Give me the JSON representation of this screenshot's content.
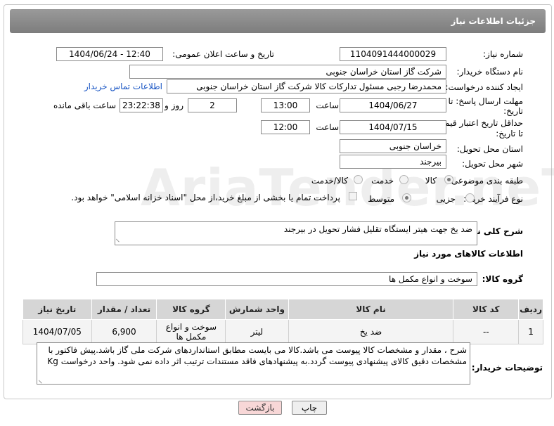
{
  "header": {
    "title": "جزئیات اطلاعات نیاز"
  },
  "fields": {
    "need_number_label": "شماره نیاز:",
    "need_number": "1104091444000029",
    "announce_label": "تاریخ و ساعت اعلان عمومی:",
    "announce_value": "1404/06/24 - 12:40",
    "buyer_org_label": "نام دستگاه خریدار:",
    "buyer_org": "شرکت گاز استان خراسان جنوبی",
    "creator_label": "ایجاد کننده درخواست:",
    "creator": "محمدرضا رجبی مسئول تدارکات کالا شرکت گاز استان خراسان جنوبی",
    "contact_link": "اطلاعات تماس خریدار",
    "deadline_label_1": "مهلت ارسال پاسخ: تا",
    "deadline_label_2": "تاریخ:",
    "deadline_date": "1404/06/27",
    "time_label": "ساعت",
    "deadline_time": "13:00",
    "days_value": "2",
    "days_label": "روز و",
    "remaining_time": "23:22:38",
    "remaining_label": "ساعت باقی مانده",
    "min_validity_label_1": "حداقل تاریخ اعتبار قیمت:",
    "min_validity_label_2": "تا تاریخ:",
    "validity_date": "1404/07/15",
    "validity_time": "12:00",
    "province_label": "استان محل تحویل:",
    "province": "خراسان جنوبی",
    "city_label": "شهر محل تحویل:",
    "city": "بیرجند",
    "category_label": "طبقه بندی موضوعی:",
    "category_options": [
      "کالا",
      "خدمت",
      "کالا/خدمت"
    ],
    "process_label": "نوع فرآیند خرید :",
    "process_options": [
      "جزیی",
      "متوسط"
    ],
    "payment_text": "پرداخت تمام یا بخشی از مبلغ خرید،از محل \"اسناد خزانه اسلامی\" خواهد بود.",
    "description_label": "شرح کلی نیاز:",
    "description": "ضد یخ جهت هیتر ایستگاه تقلیل فشار تحویل در بیرجند"
  },
  "goods": {
    "section_title": "اطلاعات کالاهای مورد نیاز",
    "group_label": "گروه کالا:",
    "group_value": "سوخت و انواع مکمل ها",
    "columns": [
      "ردیف",
      "کد کالا",
      "نام کالا",
      "واحد شمارش",
      "گروه کالا",
      "تعداد / مقدار",
      "تاریخ نیاز"
    ],
    "rows": [
      {
        "row": "1",
        "code": "--",
        "name": "ضد یخ",
        "unit": "لیتر",
        "group": "سوخت و انواع مکمل ها",
        "qty": "6,900",
        "date": "1404/07/05"
      }
    ]
  },
  "buyer_notes": {
    "label": "توضیحات خریدار:",
    "line1": "شرح ، مقدار و مشخصات کالا پیوست می باشد.کالا می بایست  مطابق استانداردهای شرکت ملی گاز باشد.پیش فاکتور با",
    "line2": "مشخصات دقیق کالای پیشنهادی پیوست گردد.به پیشنهادهای فاقد مستندات ترتیب اثر داده نمی شود. واحد درخواست Kg"
  },
  "buttons": {
    "print": "چاپ",
    "back": "بازگشت"
  },
  "watermark": {
    "brand": "AriaTender.neT"
  },
  "colors": {
    "header": "#8a8a8a",
    "link": "#1a56c4",
    "back_button": "#f8d7d7",
    "print_button": "#efefef"
  }
}
